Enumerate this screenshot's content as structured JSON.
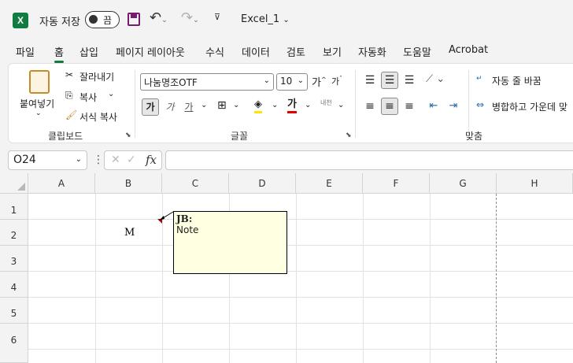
{
  "titlebar": {
    "app_icon": "excel-icon",
    "autosave_label": "자동 저장",
    "autosave_state": "끔",
    "filename": "Excel_1"
  },
  "tabs": [
    "파일",
    "홈",
    "삽입",
    "페이지 레이아웃",
    "수식",
    "데이터",
    "검토",
    "보기",
    "자동화",
    "도움말",
    "Acrobat"
  ],
  "active_tab": "홈",
  "ribbon": {
    "clipboard": {
      "paste": "붙여넣기",
      "cut": "잘라내기",
      "copy": "복사",
      "format_painter": "서식 복사",
      "group": "클립보드"
    },
    "font": {
      "font_name": "나눔명조OTF",
      "font_size": "10",
      "bold": "가",
      "italic": "가",
      "underline": "가",
      "font_color_glyph": "가",
      "phonetic": "내천",
      "group": "글꼴"
    },
    "alignment": {
      "wrap_text": "자동 줄 바꿈",
      "merge_center": "병합하고 가운데 맞",
      "group": "맞춤"
    }
  },
  "formula_bar": {
    "name_box": "O24",
    "fx": "fx",
    "value": ""
  },
  "grid": {
    "columns": [
      "A",
      "B",
      "C",
      "D",
      "E",
      "F",
      "G",
      "H"
    ],
    "rows": [
      "1",
      "2",
      "3",
      "4",
      "5",
      "6"
    ],
    "cell_B2": "M",
    "comment": {
      "author": "JB:",
      "text": "Note"
    }
  }
}
